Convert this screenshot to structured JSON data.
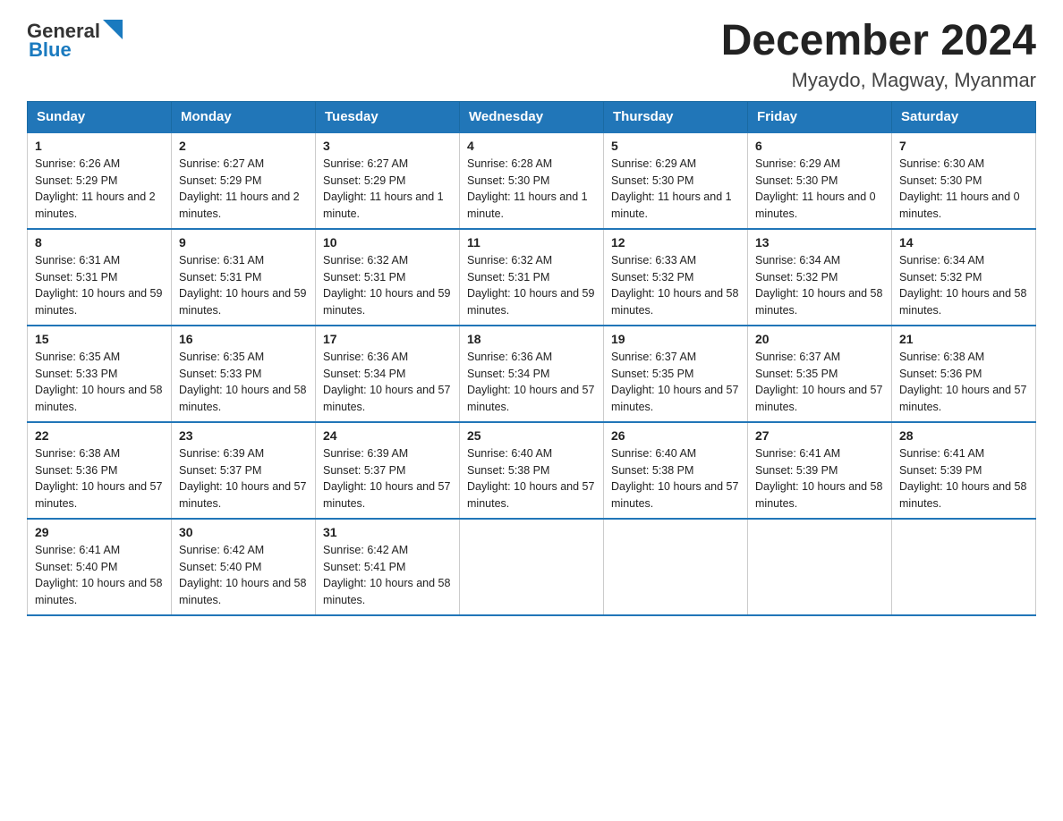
{
  "logo": {
    "general": "General",
    "blue": "Blue"
  },
  "title": {
    "month_year": "December 2024",
    "location": "Myaydo, Magway, Myanmar"
  },
  "days_header": [
    "Sunday",
    "Monday",
    "Tuesday",
    "Wednesday",
    "Thursday",
    "Friday",
    "Saturday"
  ],
  "weeks": [
    [
      {
        "day": "1",
        "sunrise": "6:26 AM",
        "sunset": "5:29 PM",
        "daylight": "11 hours and 2 minutes."
      },
      {
        "day": "2",
        "sunrise": "6:27 AM",
        "sunset": "5:29 PM",
        "daylight": "11 hours and 2 minutes."
      },
      {
        "day": "3",
        "sunrise": "6:27 AM",
        "sunset": "5:29 PM",
        "daylight": "11 hours and 1 minute."
      },
      {
        "day": "4",
        "sunrise": "6:28 AM",
        "sunset": "5:30 PM",
        "daylight": "11 hours and 1 minute."
      },
      {
        "day": "5",
        "sunrise": "6:29 AM",
        "sunset": "5:30 PM",
        "daylight": "11 hours and 1 minute."
      },
      {
        "day": "6",
        "sunrise": "6:29 AM",
        "sunset": "5:30 PM",
        "daylight": "11 hours and 0 minutes."
      },
      {
        "day": "7",
        "sunrise": "6:30 AM",
        "sunset": "5:30 PM",
        "daylight": "11 hours and 0 minutes."
      }
    ],
    [
      {
        "day": "8",
        "sunrise": "6:31 AM",
        "sunset": "5:31 PM",
        "daylight": "10 hours and 59 minutes."
      },
      {
        "day": "9",
        "sunrise": "6:31 AM",
        "sunset": "5:31 PM",
        "daylight": "10 hours and 59 minutes."
      },
      {
        "day": "10",
        "sunrise": "6:32 AM",
        "sunset": "5:31 PM",
        "daylight": "10 hours and 59 minutes."
      },
      {
        "day": "11",
        "sunrise": "6:32 AM",
        "sunset": "5:31 PM",
        "daylight": "10 hours and 59 minutes."
      },
      {
        "day": "12",
        "sunrise": "6:33 AM",
        "sunset": "5:32 PM",
        "daylight": "10 hours and 58 minutes."
      },
      {
        "day": "13",
        "sunrise": "6:34 AM",
        "sunset": "5:32 PM",
        "daylight": "10 hours and 58 minutes."
      },
      {
        "day": "14",
        "sunrise": "6:34 AM",
        "sunset": "5:32 PM",
        "daylight": "10 hours and 58 minutes."
      }
    ],
    [
      {
        "day": "15",
        "sunrise": "6:35 AM",
        "sunset": "5:33 PM",
        "daylight": "10 hours and 58 minutes."
      },
      {
        "day": "16",
        "sunrise": "6:35 AM",
        "sunset": "5:33 PM",
        "daylight": "10 hours and 58 minutes."
      },
      {
        "day": "17",
        "sunrise": "6:36 AM",
        "sunset": "5:34 PM",
        "daylight": "10 hours and 57 minutes."
      },
      {
        "day": "18",
        "sunrise": "6:36 AM",
        "sunset": "5:34 PM",
        "daylight": "10 hours and 57 minutes."
      },
      {
        "day": "19",
        "sunrise": "6:37 AM",
        "sunset": "5:35 PM",
        "daylight": "10 hours and 57 minutes."
      },
      {
        "day": "20",
        "sunrise": "6:37 AM",
        "sunset": "5:35 PM",
        "daylight": "10 hours and 57 minutes."
      },
      {
        "day": "21",
        "sunrise": "6:38 AM",
        "sunset": "5:36 PM",
        "daylight": "10 hours and 57 minutes."
      }
    ],
    [
      {
        "day": "22",
        "sunrise": "6:38 AM",
        "sunset": "5:36 PM",
        "daylight": "10 hours and 57 minutes."
      },
      {
        "day": "23",
        "sunrise": "6:39 AM",
        "sunset": "5:37 PM",
        "daylight": "10 hours and 57 minutes."
      },
      {
        "day": "24",
        "sunrise": "6:39 AM",
        "sunset": "5:37 PM",
        "daylight": "10 hours and 57 minutes."
      },
      {
        "day": "25",
        "sunrise": "6:40 AM",
        "sunset": "5:38 PM",
        "daylight": "10 hours and 57 minutes."
      },
      {
        "day": "26",
        "sunrise": "6:40 AM",
        "sunset": "5:38 PM",
        "daylight": "10 hours and 57 minutes."
      },
      {
        "day": "27",
        "sunrise": "6:41 AM",
        "sunset": "5:39 PM",
        "daylight": "10 hours and 58 minutes."
      },
      {
        "day": "28",
        "sunrise": "6:41 AM",
        "sunset": "5:39 PM",
        "daylight": "10 hours and 58 minutes."
      }
    ],
    [
      {
        "day": "29",
        "sunrise": "6:41 AM",
        "sunset": "5:40 PM",
        "daylight": "10 hours and 58 minutes."
      },
      {
        "day": "30",
        "sunrise": "6:42 AM",
        "sunset": "5:40 PM",
        "daylight": "10 hours and 58 minutes."
      },
      {
        "day": "31",
        "sunrise": "6:42 AM",
        "sunset": "5:41 PM",
        "daylight": "10 hours and 58 minutes."
      },
      null,
      null,
      null,
      null
    ]
  ],
  "labels": {
    "sunrise": "Sunrise:",
    "sunset": "Sunset:",
    "daylight": "Daylight:"
  }
}
